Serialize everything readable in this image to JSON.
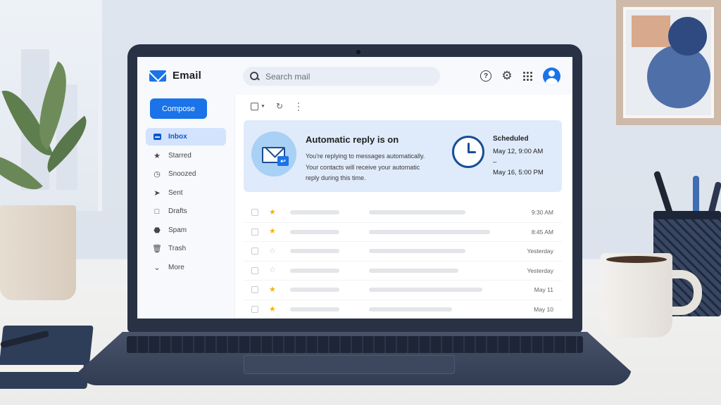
{
  "app": {
    "name": "Email",
    "brand_color": "#1a73e8"
  },
  "search": {
    "placeholder": "Search mail"
  },
  "header_icons": [
    "help-icon",
    "gear-icon",
    "apps-icon",
    "avatar"
  ],
  "sidebar": {
    "compose_label": "Compose",
    "items": [
      {
        "label": "Inbox",
        "icon": "inbox-icon",
        "active": true
      },
      {
        "label": "Starred",
        "icon": "star-icon",
        "active": false
      },
      {
        "label": "Snoozed",
        "icon": "clock-icon",
        "active": false
      },
      {
        "label": "Sent",
        "icon": "send-icon",
        "active": false
      },
      {
        "label": "Drafts",
        "icon": "draft-icon",
        "active": false
      },
      {
        "label": "Spam",
        "icon": "spam-icon",
        "active": false
      },
      {
        "label": "Trash",
        "icon": "trash-icon",
        "active": false
      },
      {
        "label": "More",
        "icon": "chevron-down-icon",
        "active": false
      }
    ]
  },
  "toolbar": {
    "icons": [
      "select-checkbox",
      "refresh-icon",
      "more-vert-icon"
    ]
  },
  "banner": {
    "title": "Automatic reply is on",
    "line1": "You're replying to messages automatically.",
    "line2": "Your contacts will receive your automatic",
    "line3": "reply during this time.",
    "schedule_title": "Scheduled",
    "start": "May 12, 9:00 AM",
    "separator": "–",
    "end": "May 16, 5:00 PM",
    "color": "#dfebfb"
  },
  "emails": [
    {
      "starred": true,
      "date": "9:30 AM"
    },
    {
      "starred": true,
      "date": "8:45 AM"
    },
    {
      "starred": false,
      "date": "Yesterday"
    },
    {
      "starred": false,
      "date": "Yesterday"
    },
    {
      "starred": true,
      "date": "May 11"
    },
    {
      "starred": true,
      "date": "May 10"
    }
  ]
}
